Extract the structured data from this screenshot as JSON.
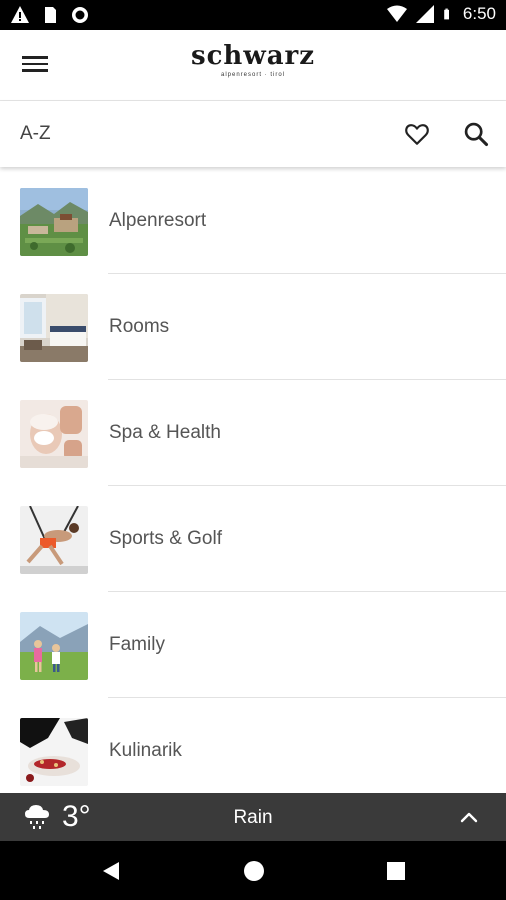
{
  "status_bar": {
    "time": "6:50",
    "left_icons": [
      "warning-icon",
      "sim-card-icon",
      "record-icon"
    ],
    "right_icons": [
      "wifi-icon",
      "signal-icon",
      "battery-icon"
    ]
  },
  "header": {
    "logo_text": "schwarz",
    "logo_subtext": "alpenresort · tirol",
    "menu_icon": "hamburger-menu-icon"
  },
  "titlebar": {
    "title": "A-Z",
    "favorite_icon": "heart-icon",
    "search_icon": "search-icon"
  },
  "items": [
    {
      "label": "Alpenresort"
    },
    {
      "label": "Rooms"
    },
    {
      "label": "Spa & Health"
    },
    {
      "label": "Sports & Golf"
    },
    {
      "label": "Family"
    },
    {
      "label": "Kulinarik"
    }
  ],
  "weather": {
    "temperature": "3°",
    "condition": "Rain",
    "icon": "rain-cloud-icon",
    "expand_icon": "chevron-up-icon"
  },
  "navbar": {
    "icons": [
      "back-icon",
      "home-icon",
      "recents-icon"
    ]
  },
  "colors": {
    "weather_bar": "#3a3a3a",
    "status_bar": "#000000",
    "text_primary": "#555555"
  }
}
